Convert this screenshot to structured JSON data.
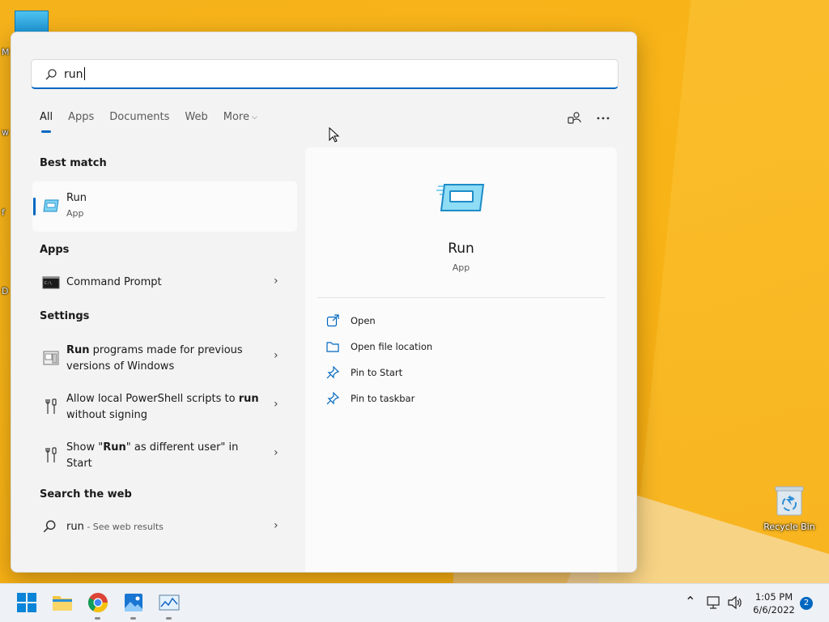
{
  "search": {
    "query": "run",
    "placeholder": ""
  },
  "tabs": [
    {
      "label": "All"
    },
    {
      "label": "Apps"
    },
    {
      "label": "Documents"
    },
    {
      "label": "Web"
    },
    {
      "label": "More"
    }
  ],
  "sections": {
    "best_match": "Best match",
    "apps": "Apps",
    "settings": "Settings",
    "web": "Search the web"
  },
  "best_match": {
    "name": "Run",
    "kind": "App"
  },
  "apps": [
    {
      "name": "Command Prompt"
    }
  ],
  "settings": [
    {
      "bold": "Run",
      "rest": " programs made for previous versions of Windows"
    },
    {
      "pre": "Allow local PowerShell scripts to ",
      "bold": "run",
      "post": " without signing"
    },
    {
      "pre": "Show \"",
      "bold": "Run",
      "post": "\" as different user\" in Start"
    }
  ],
  "web_result": {
    "query": "run",
    "suffix": " - See web results"
  },
  "detail": {
    "name": "Run",
    "kind": "App",
    "actions": [
      {
        "label": "Open",
        "icon": "open-icon"
      },
      {
        "label": "Open file location",
        "icon": "folder-icon"
      },
      {
        "label": "Pin to Start",
        "icon": "pin-icon"
      },
      {
        "label": "Pin to taskbar",
        "icon": "pin-icon"
      }
    ]
  },
  "desktop": {
    "recycle_bin": "Recycle Bin",
    "left_letters": [
      "M",
      "w",
      "f",
      "D"
    ]
  },
  "taskbar": {
    "time": "1:05 PM",
    "date": "6/6/2022",
    "notifications": "2",
    "apps": [
      "start-icon",
      "file-explorer-icon",
      "chrome-icon",
      "photos-icon",
      "task-manager-icon"
    ]
  },
  "colors": {
    "accent": "#0067c0",
    "wallpaper": "#f8b417"
  }
}
